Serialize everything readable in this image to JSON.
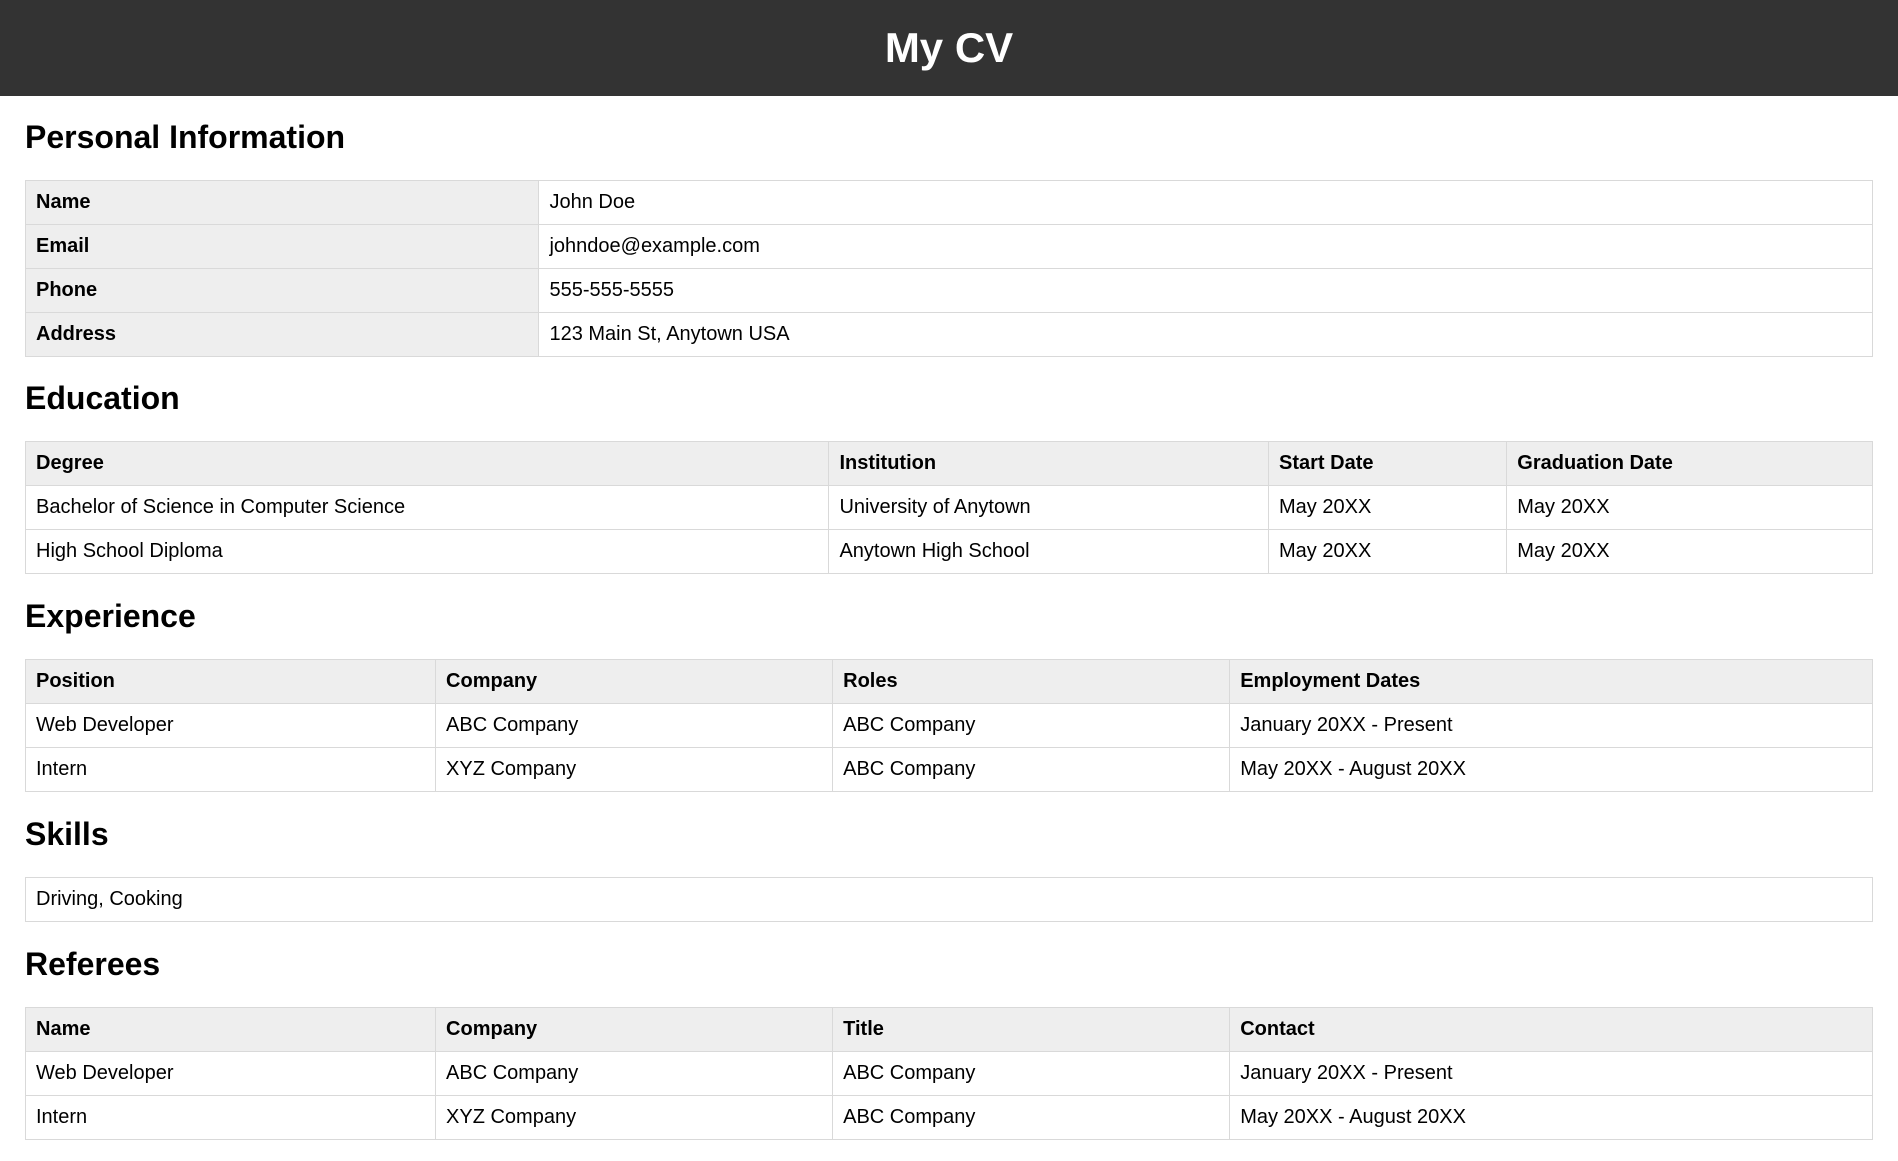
{
  "header": {
    "title": "My CV"
  },
  "personal": {
    "heading": "Personal Information",
    "rows": [
      {
        "label": "Name",
        "value": "John Doe"
      },
      {
        "label": "Email",
        "value": "johndoe@example.com"
      },
      {
        "label": "Phone",
        "value": "555-555-5555"
      },
      {
        "label": "Address",
        "value": "123 Main St, Anytown USA"
      }
    ]
  },
  "education": {
    "heading": "Education",
    "columns": [
      "Degree",
      "Institution",
      "Start Date",
      "Graduation Date"
    ],
    "rows": [
      [
        "Bachelor of Science in Computer Science",
        "University of Anytown",
        "May 20XX",
        "May 20XX"
      ],
      [
        "High School Diploma",
        "Anytown High School",
        "May 20XX",
        "May 20XX"
      ]
    ]
  },
  "experience": {
    "heading": "Experience",
    "columns": [
      "Position",
      "Company",
      "Roles",
      "Employment Dates"
    ],
    "rows": [
      [
        "Web Developer",
        "ABC Company",
        "ABC Company",
        "January 20XX - Present"
      ],
      [
        "Intern",
        "XYZ Company",
        "ABC Company",
        "May 20XX - August 20XX"
      ]
    ]
  },
  "skills": {
    "heading": "Skills",
    "text": "Driving, Cooking"
  },
  "referees": {
    "heading": "Referees",
    "columns": [
      "Name",
      "Company",
      "Title",
      "Contact"
    ],
    "rows": [
      [
        "Web Developer",
        "ABC Company",
        "ABC Company",
        "January 20XX - Present"
      ],
      [
        "Intern",
        "XYZ Company",
        "ABC Company",
        "May 20XX - August 20XX"
      ]
    ]
  }
}
